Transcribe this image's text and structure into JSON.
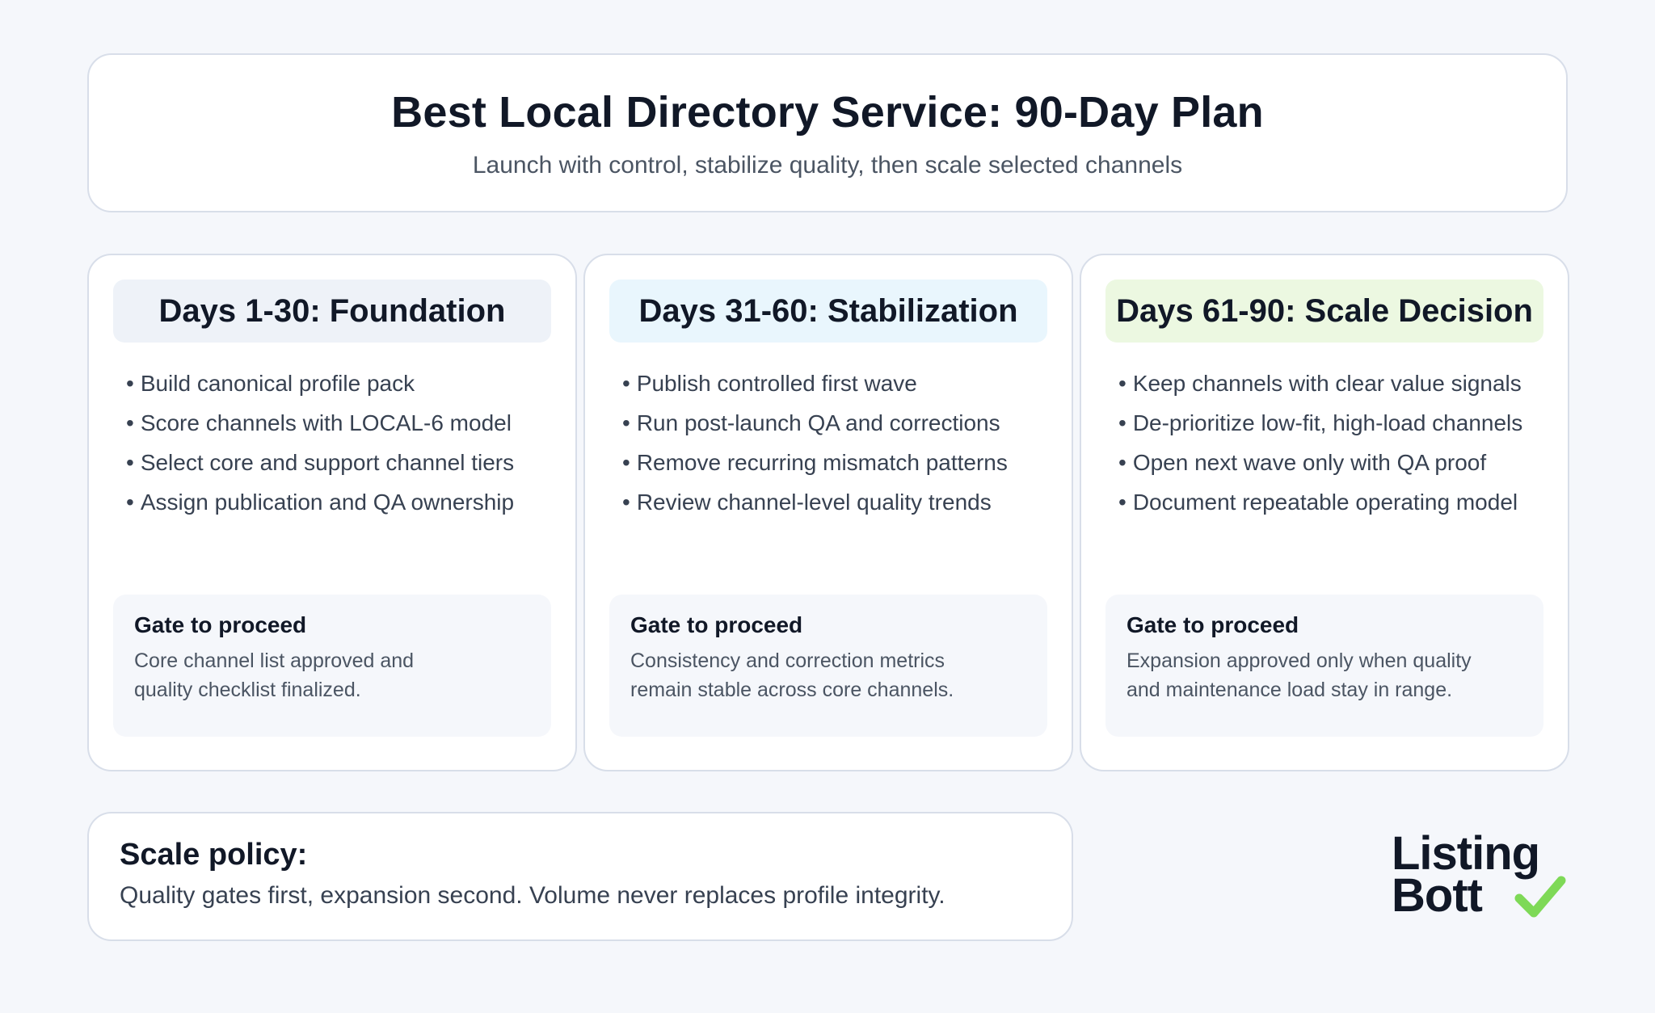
{
  "header": {
    "title": "Best Local Directory Service: 90-Day Plan",
    "subtitle": "Launch with control, stabilize quality, then scale selected channels"
  },
  "phases": [
    {
      "heading": "Days 1-30: Foundation",
      "heading_bg": "#eef2f8",
      "bullets": [
        "Build canonical profile pack",
        "Score channels with LOCAL-6 model",
        "Select core and support channel tiers",
        "Assign publication and QA ownership"
      ],
      "gate_title": "Gate to proceed",
      "gate_text": "Core channel list approved and quality checklist finalized."
    },
    {
      "heading": "Days 31-60: Stabilization",
      "heading_bg": "#e9f6fd",
      "bullets": [
        "Publish controlled first wave",
        "Run post-launch QA and corrections",
        "Remove recurring mismatch patterns",
        "Review channel-level quality trends"
      ],
      "gate_title": "Gate to proceed",
      "gate_text": "Consistency and correction metrics remain stable across core channels."
    },
    {
      "heading": "Days 61-90: Scale Decision",
      "heading_bg": "#ecf8e1",
      "bullets": [
        "Keep channels with clear value signals",
        "De-prioritize low-fit, high-load channels",
        "Open next wave only with QA proof",
        "Document repeatable operating model"
      ],
      "gate_title": "Gate to proceed",
      "gate_text": "Expansion approved only when quality and maintenance load stay in range."
    }
  ],
  "policy": {
    "title": "Scale policy:",
    "text": "Quality gates first, expansion second. Volume never replaces profile integrity."
  },
  "logo": {
    "line1": "Listing",
    "line2": "Bott",
    "icon": "check-icon",
    "check_color": "#7ed957"
  }
}
